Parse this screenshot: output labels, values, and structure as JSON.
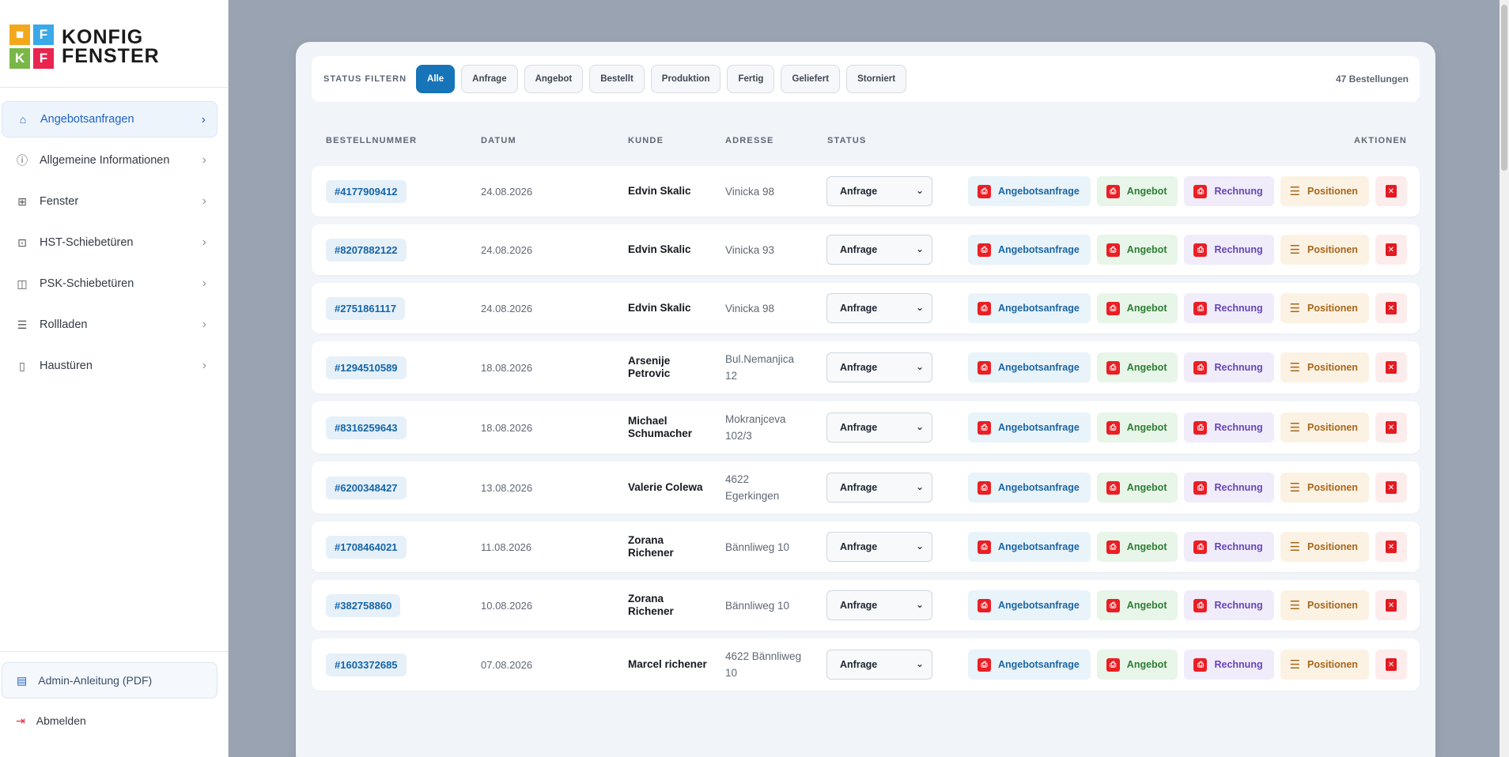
{
  "logo": {
    "cells": [
      "■",
      "F",
      "K",
      "F"
    ],
    "text_line1": "KONFIG",
    "text_line2": "FENSTER"
  },
  "sidebar": {
    "items": [
      {
        "label": "Angebotsanfragen",
        "icon": "home-icon",
        "glyph": "⌂"
      },
      {
        "label": "Allgemeine Informationen",
        "icon": "info-icon",
        "glyph": "ⓘ"
      },
      {
        "label": "Fenster",
        "icon": "window-icon",
        "glyph": "⊞"
      },
      {
        "label": "HST-Schiebetüren",
        "icon": "sliding-door-icon",
        "glyph": "⊡"
      },
      {
        "label": "PSK-Schiebetüren",
        "icon": "panel-door-icon",
        "glyph": "◫"
      },
      {
        "label": "Rollladen",
        "icon": "shutter-icon",
        "glyph": "☰"
      },
      {
        "label": "Haustüren",
        "icon": "door-icon",
        "glyph": "▯"
      }
    ],
    "admin_pdf": "Admin-Anleitung (PDF)",
    "logout": "Abmelden"
  },
  "filter": {
    "label": "STATUS FILTERN",
    "chips": [
      "Alle",
      "Anfrage",
      "Angebot",
      "Bestellt",
      "Produktion",
      "Fertig",
      "Geliefert",
      "Storniert"
    ],
    "count": "47 Bestellungen"
  },
  "table": {
    "headers": {
      "order": "BESTELLNUMMER",
      "date": "DATUM",
      "customer": "KUNDE",
      "address": "ADRESSE",
      "status": "STATUS",
      "actions": "AKTIONEN"
    },
    "action_labels": {
      "anfrage": "Angebotsanfrage",
      "angebot": "Angebot",
      "rechnung": "Rechnung",
      "positionen": "Positionen"
    },
    "rows": [
      {
        "order": "#4177909412",
        "date": "24.08.2026",
        "customer": "Edvin Skalic",
        "address": "Vinicka 98",
        "status": "Anfrage"
      },
      {
        "order": "#8207882122",
        "date": "24.08.2026",
        "customer": "Edvin Skalic",
        "address": "Vinicka 93",
        "status": "Anfrage"
      },
      {
        "order": "#2751861117",
        "date": "24.08.2026",
        "customer": "Edvin Skalic",
        "address": "Vinicka 98",
        "status": "Anfrage"
      },
      {
        "order": "#1294510589",
        "date": "18.08.2026",
        "customer": "Arsenije Petrovic",
        "address": "Bul.Nemanjica 12",
        "status": "Anfrage"
      },
      {
        "order": "#8316259643",
        "date": "18.08.2026",
        "customer": "Michael Schumacher",
        "address": "Mokranjceva 102/3",
        "status": "Anfrage"
      },
      {
        "order": "#6200348427",
        "date": "13.08.2026",
        "customer": "Valerie Colewa",
        "address": "4622 Egerkingen",
        "status": "Anfrage"
      },
      {
        "order": "#1708464021",
        "date": "11.08.2026",
        "customer": "Zorana Richener",
        "address": "Bännliweg 10",
        "status": "Anfrage"
      },
      {
        "order": "#382758860",
        "date": "10.08.2026",
        "customer": "Zorana Richener",
        "address": "Bännliweg 10",
        "status": "Anfrage"
      },
      {
        "order": "#1603372685",
        "date": "07.08.2026",
        "customer": "Marcel richener",
        "address": "4622 Bännliweg 10",
        "status": "Anfrage"
      }
    ]
  }
}
